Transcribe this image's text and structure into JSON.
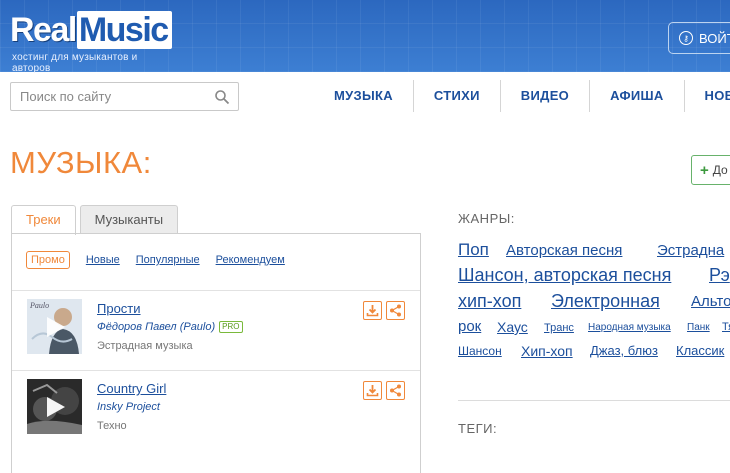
{
  "header": {
    "logo_real": "Real",
    "logo_music": "Music",
    "logo_subtitle": "хостинг для музыкантов и авторов",
    "login_label": "ВОЙТ"
  },
  "search": {
    "placeholder": "Поиск по сайту"
  },
  "nav": [
    "МУЗЫКА",
    "СТИХИ",
    "ВИДЕО",
    "АФИША",
    "НОВ"
  ],
  "page": {
    "title": "МУЗЫКА:",
    "add_label": "До"
  },
  "tabs": [
    {
      "label": "Треки",
      "active": true
    },
    {
      "label": "Музыканты",
      "active": false
    }
  ],
  "subfilter": {
    "active": "Промо",
    "links": [
      "Новые",
      "Популярные",
      "Рекомендуем"
    ]
  },
  "tracks": [
    {
      "title": "Прости",
      "artist": "Фёдоров Павел (Paulo)",
      "badge": "PRO",
      "genre": "Эстрадная музыка",
      "cover_caption": "Paulo"
    },
    {
      "title": "Country Girl",
      "artist": "Insky Project",
      "badge": "",
      "genre": "Техно",
      "cover_caption": ""
    }
  ],
  "genres_label": "ЖАНРЫ:",
  "genres": [
    "Поп",
    "Авторская песня",
    "Эстрадна",
    "Шансон, авторская песня",
    "Рэ",
    "хип-хоп",
    "Электронная",
    "Альто",
    "рок",
    "Хаус",
    "Транс",
    "Народная музыка",
    "Панк",
    "Тя",
    "Шансон",
    "Хип-хоп",
    "Джаз, блюз",
    "Классик"
  ],
  "tags_label": "ТЕГИ:",
  "colors": {
    "brand_blue": "#2f6fc4",
    "accent_orange": "#f0883a",
    "link_blue": "#1c4f9c",
    "pro_green": "#7ab93b"
  }
}
